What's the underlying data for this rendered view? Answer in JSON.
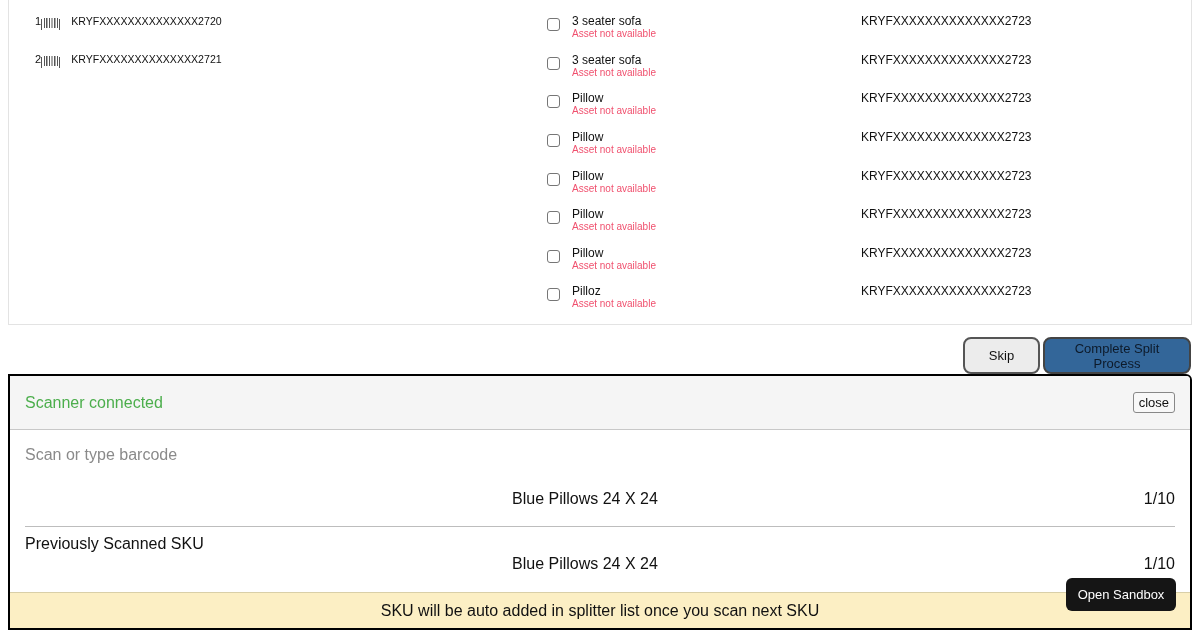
{
  "split_items": [
    {
      "index": "1",
      "code": "KRYFXXXXXXXXXXXXXX2720"
    },
    {
      "index": "2",
      "code": "KRYFXXXXXXXXXXXXXX2721"
    }
  ],
  "assets": [
    {
      "name": "3 seater sofa",
      "status": "Asset not available",
      "code": "KRYFXXXXXXXXXXXXXX2723",
      "checked": false
    },
    {
      "name": "3 seater sofa",
      "status": "Asset not available",
      "code": "KRYFXXXXXXXXXXXXXX2723",
      "checked": false
    },
    {
      "name": "Pillow",
      "status": "Asset not available",
      "code": "KRYFXXXXXXXXXXXXXX2723",
      "checked": false
    },
    {
      "name": "Pillow",
      "status": "Asset not available",
      "code": "KRYFXXXXXXXXXXXXXX2723",
      "checked": false
    },
    {
      "name": "Pillow",
      "status": "Asset not available",
      "code": "KRYFXXXXXXXXXXXXXX2723",
      "checked": false
    },
    {
      "name": "Pillow",
      "status": "Asset not available",
      "code": "KRYFXXXXXXXXXXXXXX2723",
      "checked": false
    },
    {
      "name": "Pillow",
      "status": "Asset not available",
      "code": "KRYFXXXXXXXXXXXXXX2723",
      "checked": false
    },
    {
      "name": "Pilloz",
      "status": "Asset not available",
      "code": "KRYFXXXXXXXXXXXXXX2723",
      "checked": false
    }
  ],
  "actions": [
    {
      "label": "Skip",
      "kind": "secondary"
    },
    {
      "label": "Complete Split Process",
      "kind": "primary"
    }
  ],
  "scanner": {
    "status": "Scanner connected",
    "close_button": "close",
    "barcode_field": {
      "placeholder": "Scan or type barcode"
    },
    "current": {
      "name": "Blue Pillows 24 X 24",
      "count": "1/10"
    },
    "previous": {
      "heading": "Previously Scanned SKU",
      "name": "Blue Pillows 24 X 24",
      "count": "1/10"
    },
    "notice": "SKU will be auto added in splitter list once you scan next SKU"
  },
  "sandbox_button": "Open Sandbox"
}
